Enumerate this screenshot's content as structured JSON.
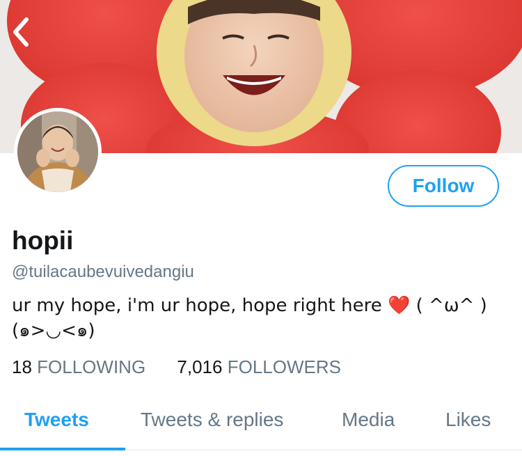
{
  "header": {
    "back_icon": "chevron-left-icon"
  },
  "profile": {
    "display_name": "hopii",
    "handle": "@tuilacaubevuivedangiu",
    "bio_text": "ur my hope, i'm ur hope, hope right here",
    "bio_emoji": "❤️",
    "bio_kaomoji_1": "( ^ω^ )",
    "bio_line2": "(๑>◡<๑)",
    "follow_label": "Follow"
  },
  "stats": {
    "following_count": "18",
    "following_label": "FOLLOWING",
    "followers_count": "7,016",
    "followers_label": "FOLLOWERS"
  },
  "tabs": [
    {
      "label": "Tweets",
      "active": true
    },
    {
      "label": "Tweets & replies",
      "active": false
    },
    {
      "label": "Media",
      "active": false
    },
    {
      "label": "Likes",
      "active": false
    }
  ],
  "colors": {
    "accent": "#1da1f2",
    "text_primary": "#14171a",
    "text_secondary": "#657786",
    "heart": "#e0245e"
  }
}
